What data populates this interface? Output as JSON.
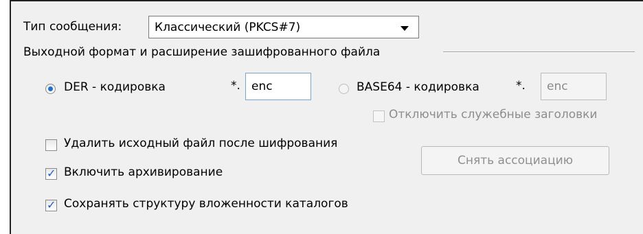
{
  "message_type": {
    "label": "Тип сообщения:",
    "selected": "Классический (PKCS#7)"
  },
  "output_format": {
    "group_title": "Выходной формат и расширение зашифрованного файла",
    "der": {
      "label": "DER - кодировка",
      "selected": true,
      "ext_prefix": "*.",
      "ext_value": "enc"
    },
    "base64": {
      "label": "BASE64 - кодировка",
      "selected": false,
      "ext_prefix": "*.",
      "ext_value": "enc"
    },
    "disable_headers": {
      "label": "Отключить служебные заголовки",
      "checked": false,
      "enabled": false
    }
  },
  "options": {
    "delete_source": {
      "label": "Удалить исходный файл после шифрования",
      "checked": false
    },
    "archive": {
      "label": "Включить архивирование",
      "checked": true
    },
    "keep_structure": {
      "label": "Сохранять структуру вложенности каталогов",
      "checked": true
    }
  },
  "remove_association_button": {
    "label": "Снять ассоциацию",
    "enabled": false
  },
  "colors": {
    "accent": "#1f6fd1",
    "panel_bg": "#f0f0f0",
    "disabled_text": "#8d8d8d"
  }
}
